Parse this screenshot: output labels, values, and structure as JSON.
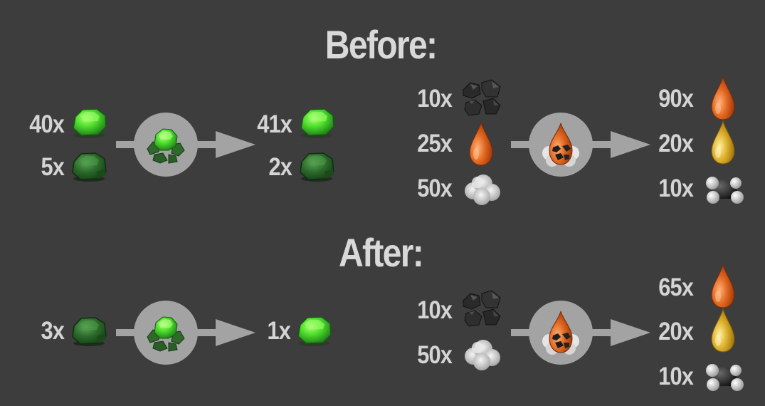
{
  "headings": {
    "before": "Before:",
    "after": "After:"
  },
  "colors": {
    "background": "#3d3d3d",
    "text": "#d4d4d4",
    "arrow": "#a3a3a3",
    "circle": "#a3a3a3",
    "uranium_green": "#3ec832",
    "heavy_oil": "#d2601c",
    "light_oil": "#d8aa26"
  },
  "before": {
    "uranium_processing": {
      "recipe_icon": "uranium-processing-icon",
      "inputs": [
        {
          "amount": "40x",
          "item": "uranium-235-icon"
        },
        {
          "amount": "5x",
          "item": "uranium-238-icon"
        }
      ],
      "outputs": [
        {
          "amount": "41x",
          "item": "uranium-235-icon"
        },
        {
          "amount": "2x",
          "item": "uranium-238-icon"
        }
      ]
    },
    "coal_liquefaction": {
      "recipe_icon": "coal-liquefaction-icon",
      "inputs": [
        {
          "amount": "10x",
          "item": "coal-icon"
        },
        {
          "amount": "25x",
          "item": "heavy-oil-icon"
        },
        {
          "amount": "50x",
          "item": "steam-icon"
        }
      ],
      "outputs": [
        {
          "amount": "90x",
          "item": "heavy-oil-icon"
        },
        {
          "amount": "20x",
          "item": "light-oil-icon"
        },
        {
          "amount": "10x",
          "item": "petroleum-gas-icon"
        }
      ]
    }
  },
  "after": {
    "uranium_processing": {
      "recipe_icon": "uranium-processing-icon",
      "inputs": [
        {
          "amount": "3x",
          "item": "uranium-238-icon"
        }
      ],
      "outputs": [
        {
          "amount": "1x",
          "item": "uranium-235-icon"
        }
      ]
    },
    "coal_liquefaction": {
      "recipe_icon": "coal-liquefaction-icon",
      "inputs": [
        {
          "amount": "10x",
          "item": "coal-icon"
        },
        {
          "amount": "50x",
          "item": "steam-icon"
        }
      ],
      "outputs": [
        {
          "amount": "65x",
          "item": "heavy-oil-icon"
        },
        {
          "amount": "20x",
          "item": "light-oil-icon"
        },
        {
          "amount": "10x",
          "item": "petroleum-gas-icon"
        }
      ]
    }
  }
}
